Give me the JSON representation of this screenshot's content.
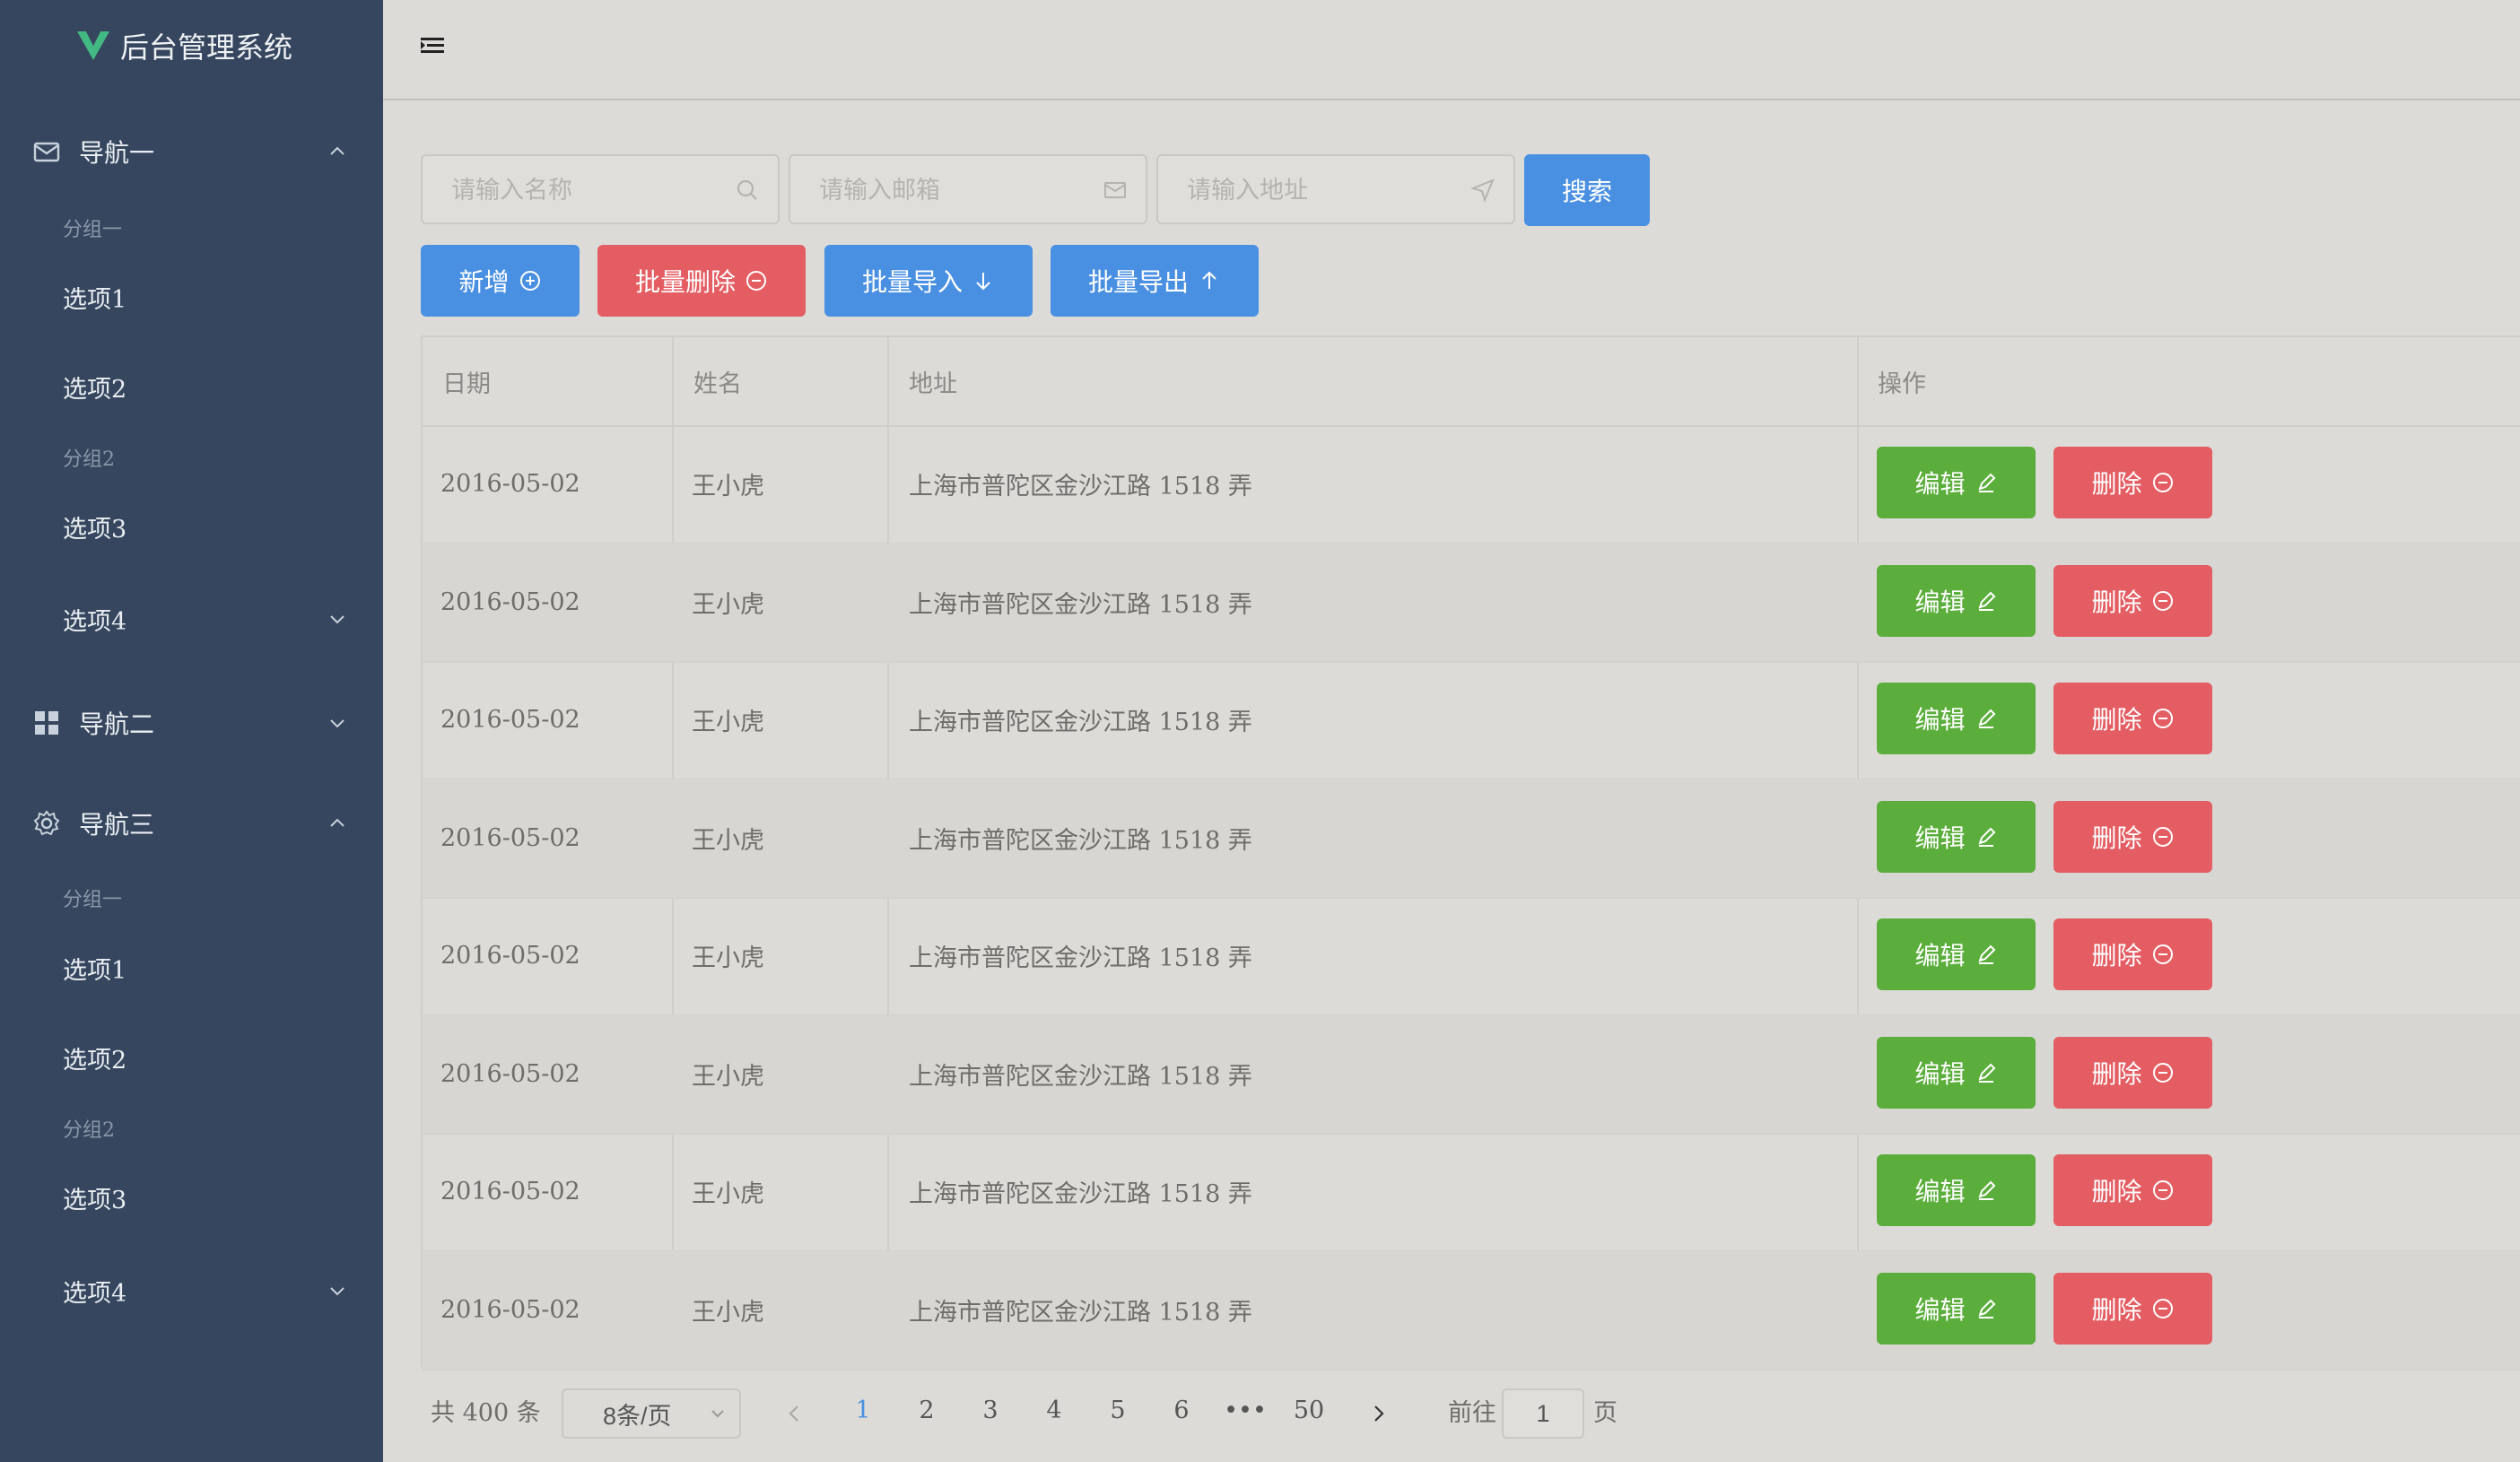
{
  "app": {
    "title": "后台管理系统"
  },
  "sidebar": {
    "nav1": {
      "label": "导航一",
      "group1": "分组一",
      "item1": "选项1",
      "item2": "选项2",
      "group2": "分组2",
      "item3": "选项3",
      "item4": "选项4"
    },
    "nav2": {
      "label": "导航二"
    },
    "nav3": {
      "label": "导航三",
      "group1": "分组一",
      "item1": "选项1",
      "item2": "选项2",
      "group2": "分组2",
      "item3": "选项3",
      "item4": "选项4"
    }
  },
  "search": {
    "name_placeholder": "请输入名称",
    "email_placeholder": "请输入邮箱",
    "address_placeholder": "请输入地址",
    "search_label": "搜索"
  },
  "toolbar": {
    "add_label": "新增",
    "batch_delete_label": "批量删除",
    "batch_import_label": "批量导入",
    "batch_export_label": "批量导出"
  },
  "table": {
    "headers": {
      "date": "日期",
      "name": "姓名",
      "address": "地址",
      "actions": "操作"
    },
    "edit_label": "编辑",
    "delete_label": "删除",
    "rows": [
      {
        "date": "2016-05-02",
        "name": "王小虎",
        "address": "上海市普陀区金沙江路 1518 弄"
      },
      {
        "date": "2016-05-02",
        "name": "王小虎",
        "address": "上海市普陀区金沙江路 1518 弄"
      },
      {
        "date": "2016-05-02",
        "name": "王小虎",
        "address": "上海市普陀区金沙江路 1518 弄"
      },
      {
        "date": "2016-05-02",
        "name": "王小虎",
        "address": "上海市普陀区金沙江路 1518 弄"
      },
      {
        "date": "2016-05-02",
        "name": "王小虎",
        "address": "上海市普陀区金沙江路 1518 弄"
      },
      {
        "date": "2016-05-02",
        "name": "王小虎",
        "address": "上海市普陀区金沙江路 1518 弄"
      },
      {
        "date": "2016-05-02",
        "name": "王小虎",
        "address": "上海市普陀区金沙江路 1518 弄"
      },
      {
        "date": "2016-05-02",
        "name": "王小虎",
        "address": "上海市普陀区金沙江路 1518 弄"
      }
    ]
  },
  "pagination": {
    "total_text": "共 400 条",
    "page_size": "8条/页",
    "pages": [
      "1",
      "2",
      "3",
      "4",
      "5",
      "6",
      "•••",
      "50"
    ],
    "current": "1",
    "goto_prefix": "前往",
    "goto_value": "1",
    "goto_suffix": "页"
  },
  "colors": {
    "sidebar": "#36465e",
    "primary": "#4a90e2",
    "danger": "#e35d62",
    "success": "#5bae3c",
    "logo": "#42b983"
  }
}
